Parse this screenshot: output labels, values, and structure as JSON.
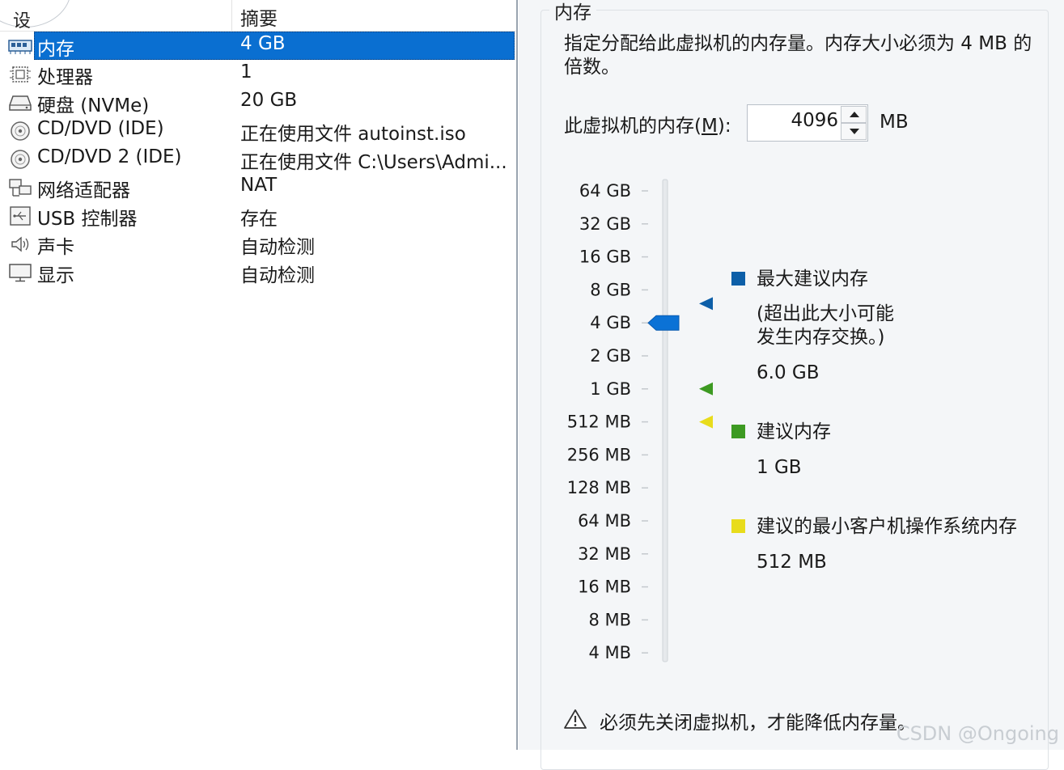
{
  "device_list": {
    "header_device": "设",
    "header_summary": "摘要",
    "rows": [
      {
        "icon": "memory-icon",
        "label": "内存",
        "summary": "4 GB",
        "selected": true
      },
      {
        "icon": "processor-icon",
        "label": "处理器",
        "summary": "1"
      },
      {
        "icon": "hard-disk-icon",
        "label": "硬盘 (NVMe)",
        "summary": "20 GB"
      },
      {
        "icon": "cd-dvd-icon",
        "label": "CD/DVD (IDE)",
        "summary": "正在使用文件 autoinst.iso"
      },
      {
        "icon": "cd-dvd-icon",
        "label": "CD/DVD 2 (IDE)",
        "summary": "正在使用文件 C:\\Users\\Admi..."
      },
      {
        "icon": "network-adapter-icon",
        "label": "网络适配器",
        "summary": "NAT"
      },
      {
        "icon": "usb-icon",
        "label": "USB 控制器",
        "summary": "存在"
      },
      {
        "icon": "speaker-icon",
        "label": "声卡",
        "summary": "自动检测"
      },
      {
        "icon": "monitor-icon",
        "label": "显示",
        "summary": "自动检测"
      }
    ]
  },
  "memory_panel": {
    "title": "内存",
    "description": "指定分配给此虚拟机的内存量。内存大小必须为 4 MB 的倍数。",
    "memory_label_prefix": "此虚拟机的内存(",
    "memory_label_key": "M",
    "memory_label_suffix": "):",
    "memory_value": "4096",
    "memory_unit": "MB",
    "scale_labels": [
      "64 GB",
      "32 GB",
      "16 GB",
      "8 GB",
      "4 GB",
      "2 GB",
      "1 GB",
      "512 MB",
      "256 MB",
      "128 MB",
      "64 MB",
      "32 MB",
      "16 MB",
      "8 MB",
      "4 MB"
    ],
    "slider_value": "4 GB",
    "markers": {
      "max_recommended": "6.0 GB",
      "recommended": "1 GB",
      "min_guest": "512 MB"
    },
    "legend": [
      {
        "key": "max",
        "color": "#0d5fa8",
        "title": "最大建议内存",
        "note_line1": "(超出此大小可能",
        "note_line2": "发生内存交换。)",
        "value": "6.0 GB"
      },
      {
        "key": "rec",
        "color": "#3d9a22",
        "title": "建议内存",
        "value": "1 GB"
      },
      {
        "key": "min",
        "color": "#e8dc1c",
        "title": "建议的最小客户机操作系统内存",
        "value": "512 MB"
      }
    ],
    "warning": "必须先关闭虚拟机，才能降低内存量。"
  },
  "watermark": "CSDN @Ongoing"
}
